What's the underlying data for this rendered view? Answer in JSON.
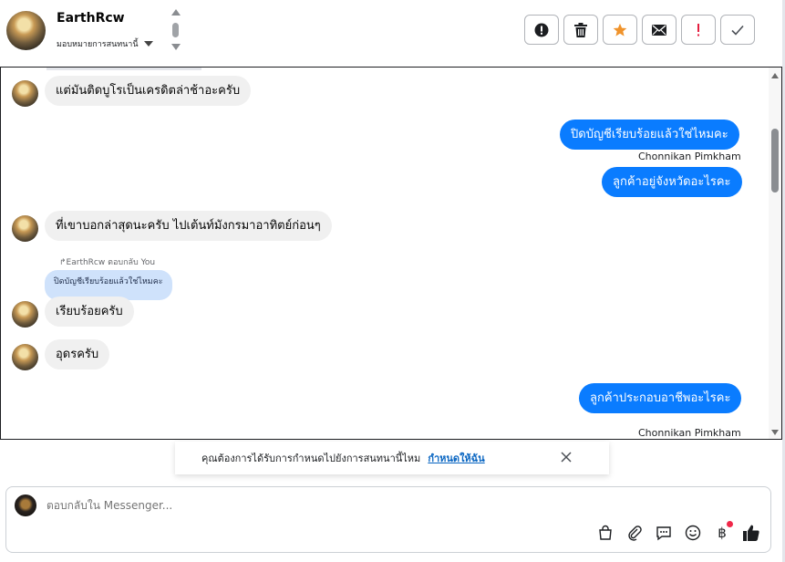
{
  "header": {
    "contact_name": "EarthRcw",
    "assign_label": "มอบหมายการสนทนานี้"
  },
  "actions": [
    {
      "name": "report-button",
      "icon": "alert-circle-icon"
    },
    {
      "name": "delete-button",
      "icon": "trash-icon"
    },
    {
      "name": "star-button",
      "icon": "star-icon",
      "color": "#f0932b"
    },
    {
      "name": "mark-unread-button",
      "icon": "mail-icon"
    },
    {
      "name": "spam-button",
      "icon": "exclamation-icon",
      "color": "#e41e3f"
    },
    {
      "name": "done-button",
      "icon": "check-icon"
    }
  ],
  "messages": {
    "m1": "แต่มันติดบูโรเป็นเครดิตล่าช้าอะครับ",
    "m2": "ปิดบัญชีเรียบร้อยแล้วใช่ไหมคะ",
    "m2_sender": "Chonnikan Pimkham",
    "m3": "ลูกค้าอยู่จังหวัดอะไรคะ",
    "m4": "ที่เขาบอกล่าสุดนะครับ ไปเต้นท์มังกรมาอาทิตย์ก่อนๆ",
    "reply_note": "EarthRcw ตอบกลับ You",
    "quoted": "ปิดบัญชีเรียบร้อยแล้วใช่ไหมคะ",
    "m5": "เรียบร้อยครับ",
    "m6": "อุดรครับ",
    "m7": "ลูกค้าประกอบอาชีพอะไรคะ",
    "m7_sender": "Chonnikan Pimkham"
  },
  "banner": {
    "text": "คุณต้องการได้รับการกำหนดไปยังการสนทนานี้ไหม",
    "link": "กำหนดให้ฉัน"
  },
  "composer": {
    "placeholder": "ตอบกลับใน Messenger..."
  },
  "colors": {
    "outgoing": "#0a7cff",
    "incoming": "#f0f0f0",
    "quoted": "#cfe2fb",
    "link": "#0a66c2"
  }
}
